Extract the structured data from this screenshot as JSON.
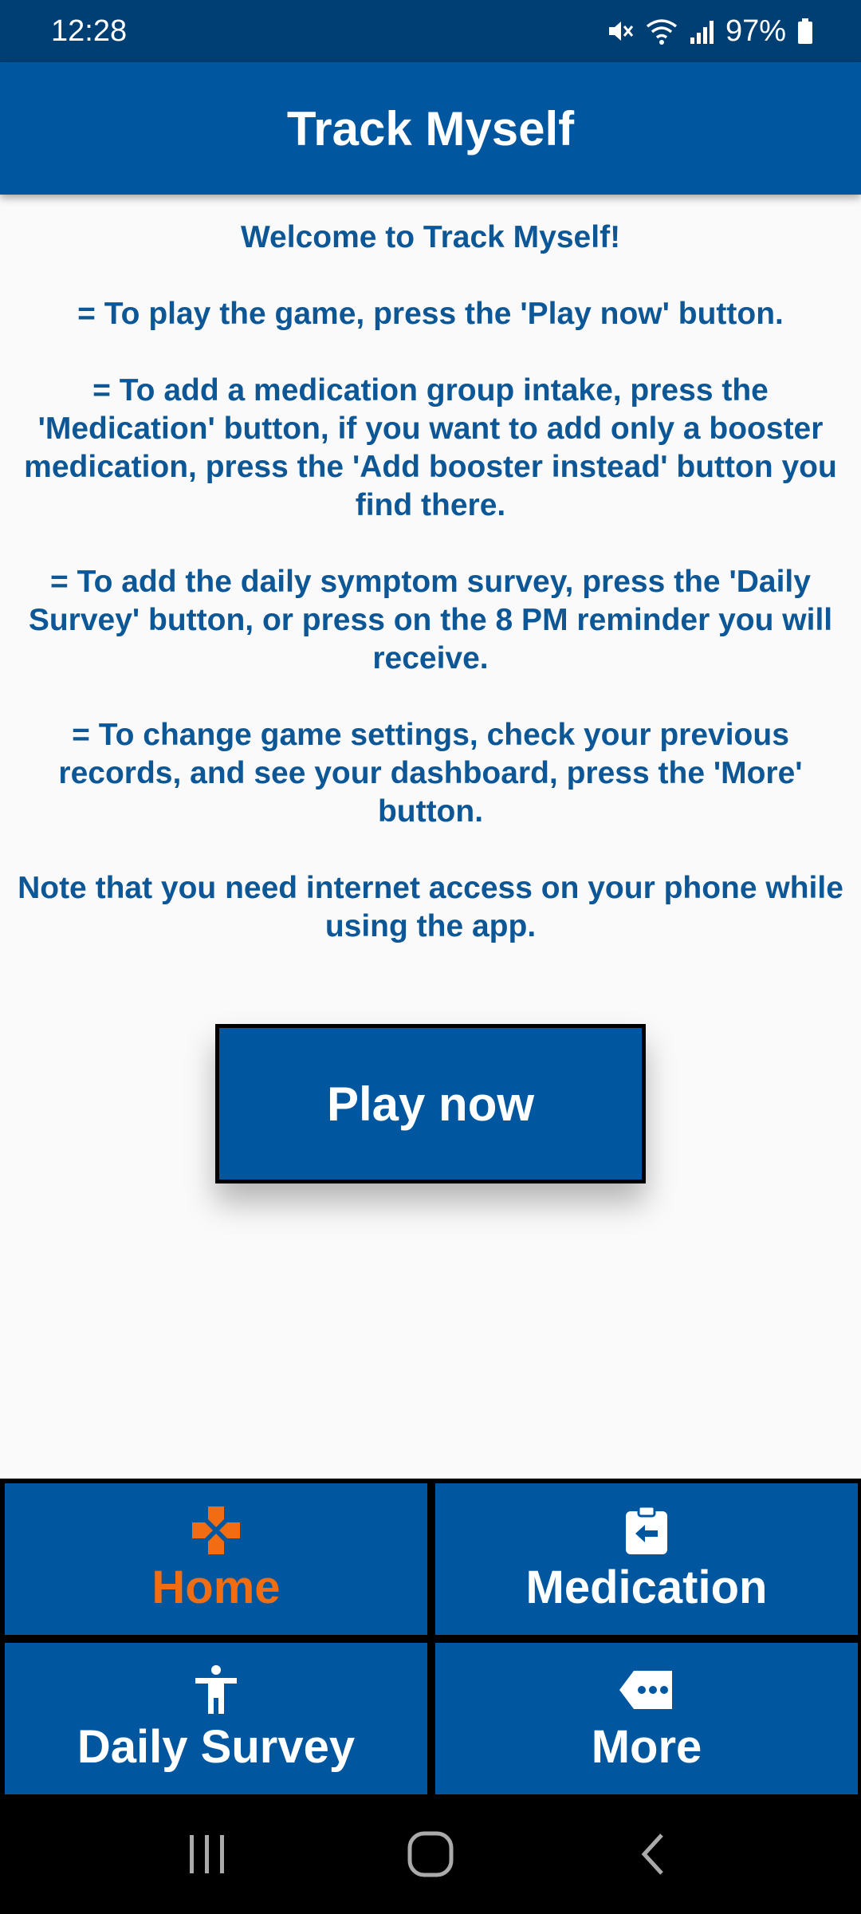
{
  "status_bar": {
    "time": "12:28",
    "battery": "97%"
  },
  "app": {
    "title": "Track Myself"
  },
  "instructions": {
    "welcome": "Welcome to Track Myself!",
    "play": "= To play the game, press the 'Play now' button.",
    "medication": "= To add a medication group intake, press the 'Medication' button, if you want to add only a booster medication, press the 'Add booster instead' button you find there.",
    "survey": "= To add the daily symptom survey, press the 'Daily Survey' button, or press on the 8 PM reminder you will receive.",
    "settings": "= To change game settings, check your previous records, and see your dashboard, press the 'More' button.",
    "note": "Note that you need internet access on your phone while using the app."
  },
  "play_button": {
    "label": "Play now"
  },
  "bottom_nav": {
    "items": [
      {
        "label": "Home",
        "icon": "gamepad-icon",
        "active": true
      },
      {
        "label": "Medication",
        "icon": "clipboard-arrow-icon",
        "active": false
      },
      {
        "label": "Daily Survey",
        "icon": "person-icon",
        "active": false
      },
      {
        "label": "More",
        "icon": "more-tag-icon",
        "active": false
      }
    ]
  },
  "colors": {
    "primary": "#0057a0",
    "status_bar": "#003f74",
    "text": "#0d5796",
    "active": "#f26d12"
  }
}
